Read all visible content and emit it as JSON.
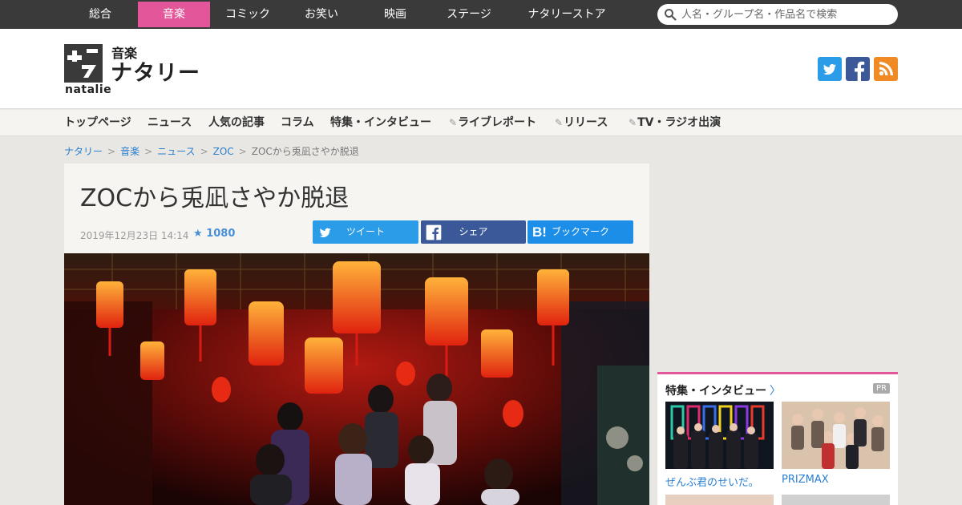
{
  "topnav": {
    "items": [
      {
        "label": "総合"
      },
      {
        "label": "音楽",
        "active": true
      },
      {
        "label": "コミック"
      },
      {
        "label": "お笑い"
      },
      {
        "label": "映画"
      },
      {
        "label": "ステージ"
      },
      {
        "label": "ナタリーストア"
      }
    ],
    "search_placeholder": "人名・グループ名・作品名で検索"
  },
  "header": {
    "logo_category": "音楽",
    "logo_name": "ナタリー",
    "logo_sub": "natalie",
    "social": [
      "twitter-icon",
      "facebook-icon",
      "rss-icon"
    ]
  },
  "subnav": {
    "items": [
      {
        "label": "トップページ"
      },
      {
        "label": "ニュース"
      },
      {
        "label": "人気の記事"
      },
      {
        "label": "コラム"
      },
      {
        "label": "特集・インタビュー"
      },
      {
        "label": "ライブレポート"
      },
      {
        "label": "リリース"
      },
      {
        "label": "TV・ラジオ出演"
      }
    ]
  },
  "breadcrumb": {
    "items": [
      "ナタリー",
      "音楽",
      "ニュース",
      "ZOC"
    ],
    "current": "ZOCから兎凪さやか脱退"
  },
  "article": {
    "title": "ZOCから兎凪さやか脱退",
    "date": "2019年12月23日 14:14",
    "stars": "1080",
    "share": {
      "tweet": "ツイート",
      "facebook": "シェア",
      "hatena": "ブックマーク"
    }
  },
  "sidebar": {
    "title": "特集・インタビュー",
    "pr": "PR",
    "items": [
      {
        "caption": "ぜんぶ君のせいだ。"
      },
      {
        "caption": "PRIZMAX"
      }
    ]
  },
  "colors": {
    "accent": "#e4569a",
    "link": "#2a7fd0",
    "twitter": "#2b9de8",
    "facebook": "#3b5998",
    "hatena": "#1c8ee8",
    "rss": "#f08a24"
  }
}
